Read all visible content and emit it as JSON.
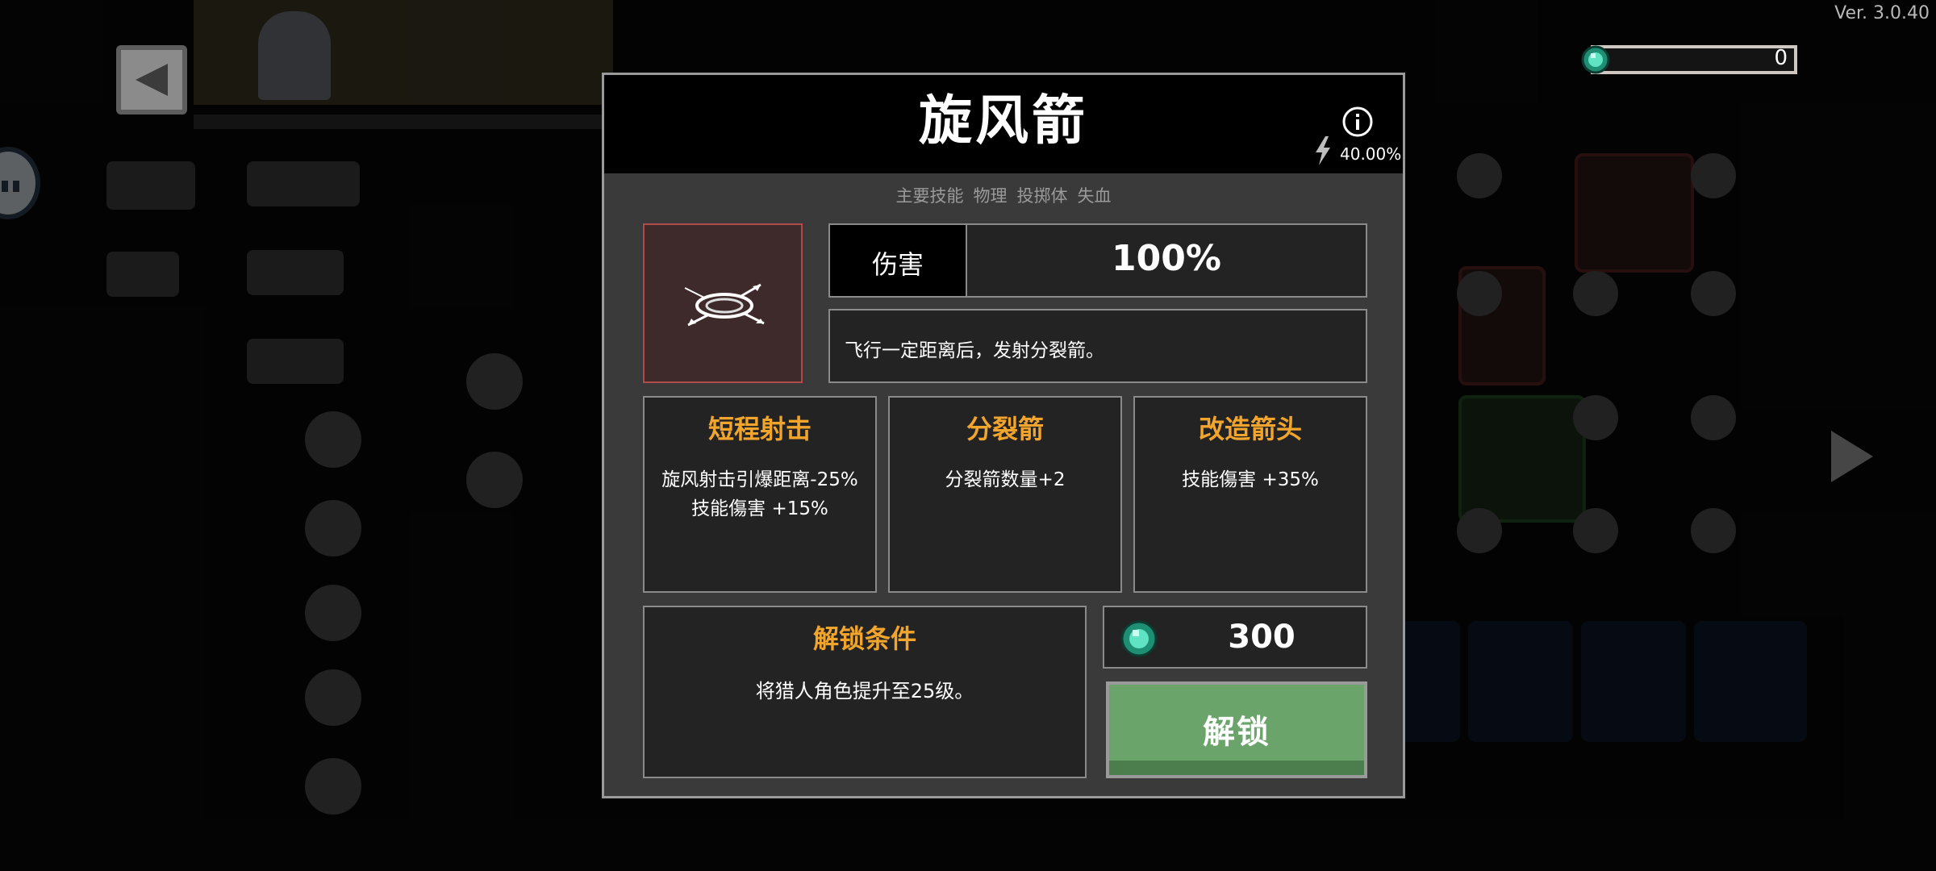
{
  "header": {
    "version": "Ver. 3.0.40",
    "currency_amount": "0"
  },
  "modal": {
    "title": "旋风箭",
    "crit_chance": "40.00%",
    "tags": [
      "主要技能",
      "物理",
      "投掷体",
      "失血"
    ],
    "stat": {
      "label": "伤害",
      "value": "100%"
    },
    "description": "飞行一定距离后，发射分裂箭。",
    "upgrades": [
      {
        "title": "短程射击",
        "lines": [
          "旋风射击引爆距离-25%",
          "技能傷害 +15%"
        ]
      },
      {
        "title": "分裂箭",
        "lines": [
          "分裂箭数量+2"
        ]
      },
      {
        "title": "改造箭头",
        "lines": [
          "技能傷害 +35%"
        ]
      }
    ],
    "unlock_condition": {
      "title": "解锁条件",
      "text": "将猎人角色提升至25级。"
    },
    "cost": "300",
    "unlock_button": "解锁"
  },
  "colors": {
    "accent_orange": "#f2a52c",
    "button_green": "#6aa46a",
    "icon_frame_red": "#b34a4a",
    "gem_teal": "#2fbf9b"
  },
  "icons": [
    "back-arrow-icon",
    "gem-icon",
    "info-icon",
    "lightning-icon",
    "whirlwind-arrow-icon",
    "next-arrow-icon"
  ]
}
